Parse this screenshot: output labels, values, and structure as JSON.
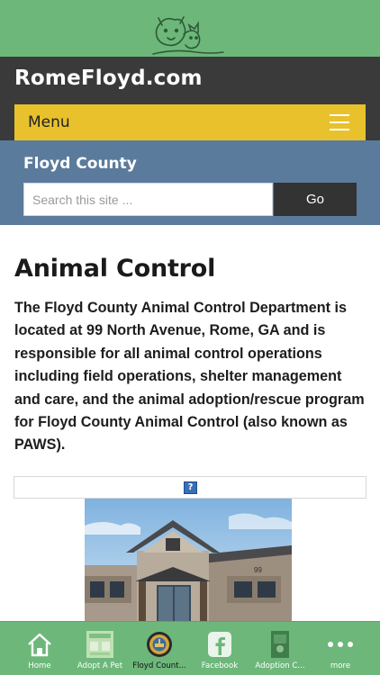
{
  "site": {
    "title": "RomeFloyd.com",
    "menu_label": "Menu"
  },
  "search": {
    "section_title": "Floyd County",
    "placeholder": "Search this site ...",
    "button_label": "Go"
  },
  "article": {
    "title": "Animal Control",
    "intro": "The Floyd County Animal Control Department is located at 99 North Avenue, Rome, GA and is responsible for all animal control operations including field operations, shelter management and care, and the animal adoption/rescue program for Floyd County Animal Control (also known as PAWS).",
    "broken_image_glyph": "?",
    "building_number": "99"
  },
  "tabs": [
    {
      "label": "Home",
      "icon": "home-icon"
    },
    {
      "label": "Adopt A Pet",
      "icon": "adopt-thumbnail-icon"
    },
    {
      "label": "Floyd Count...",
      "icon": "floyd-county-seal-icon",
      "active": true
    },
    {
      "label": "Facebook",
      "icon": "facebook-icon"
    },
    {
      "label": "Adoption C...",
      "icon": "adoption-center-thumbnail-icon"
    },
    {
      "label": "more",
      "icon": "more-dots-icon"
    }
  ],
  "colors": {
    "banner_green": "#6db77a",
    "header_dark": "#3a3a3a",
    "menu_yellow": "#e8c12d",
    "search_blue": "#5b7b9c"
  }
}
